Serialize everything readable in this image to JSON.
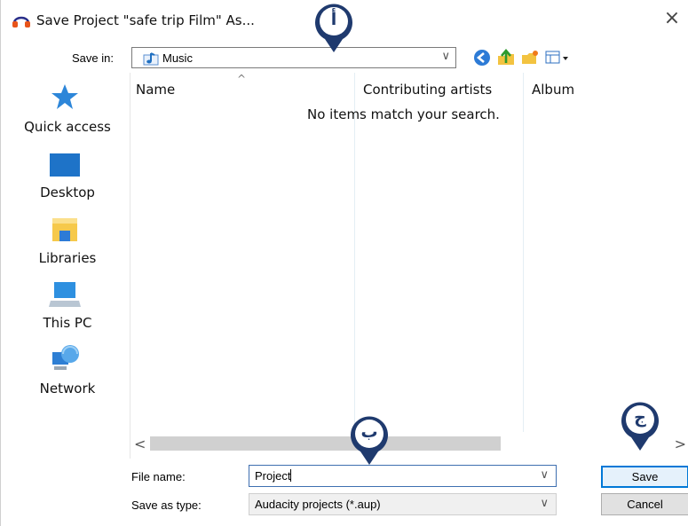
{
  "window": {
    "title": "Save Project \"safe trip Film\" As...",
    "close_glyph": "×",
    "app_icon": "headphones-icon"
  },
  "toolbar": {
    "save_in_label": "Save in:",
    "save_in_value": "Music",
    "save_in_icon": "music-folder-icon",
    "buttons": [
      "back-icon",
      "up-folder-icon",
      "new-folder-icon",
      "view-menu-icon"
    ]
  },
  "places": [
    {
      "label": "Quick access",
      "icon": "star-pin-icon"
    },
    {
      "label": "Desktop",
      "icon": "desktop-icon"
    },
    {
      "label": "Libraries",
      "icon": "libraries-icon"
    },
    {
      "label": "This PC",
      "icon": "computer-icon"
    },
    {
      "label": "Network",
      "icon": "network-icon"
    }
  ],
  "filelist": {
    "columns": [
      "Name",
      "Contributing artists",
      "Album"
    ],
    "sort_indicator": "^",
    "empty_message": "No items match your search.",
    "scroll_left": "<",
    "scroll_right": ">"
  },
  "form": {
    "file_name_label": "File name:",
    "file_name_value": "Project",
    "save_as_type_label": "Save as type:",
    "save_as_type_value": "Audacity projects (*.aup)",
    "dropdown_glyph": "∨"
  },
  "buttons": {
    "save": "Save",
    "cancel": "Cancel"
  },
  "callouts": [
    {
      "letter": "أ"
    },
    {
      "letter": "ب"
    },
    {
      "letter": "ج"
    }
  ],
  "colors": {
    "accent": "#0078d7",
    "pin_outer": "#1f3a6e",
    "pin_inner": "#ffffff",
    "desktop_blue": "#1e73c8",
    "libraries_yellow": "#f6c94b"
  }
}
